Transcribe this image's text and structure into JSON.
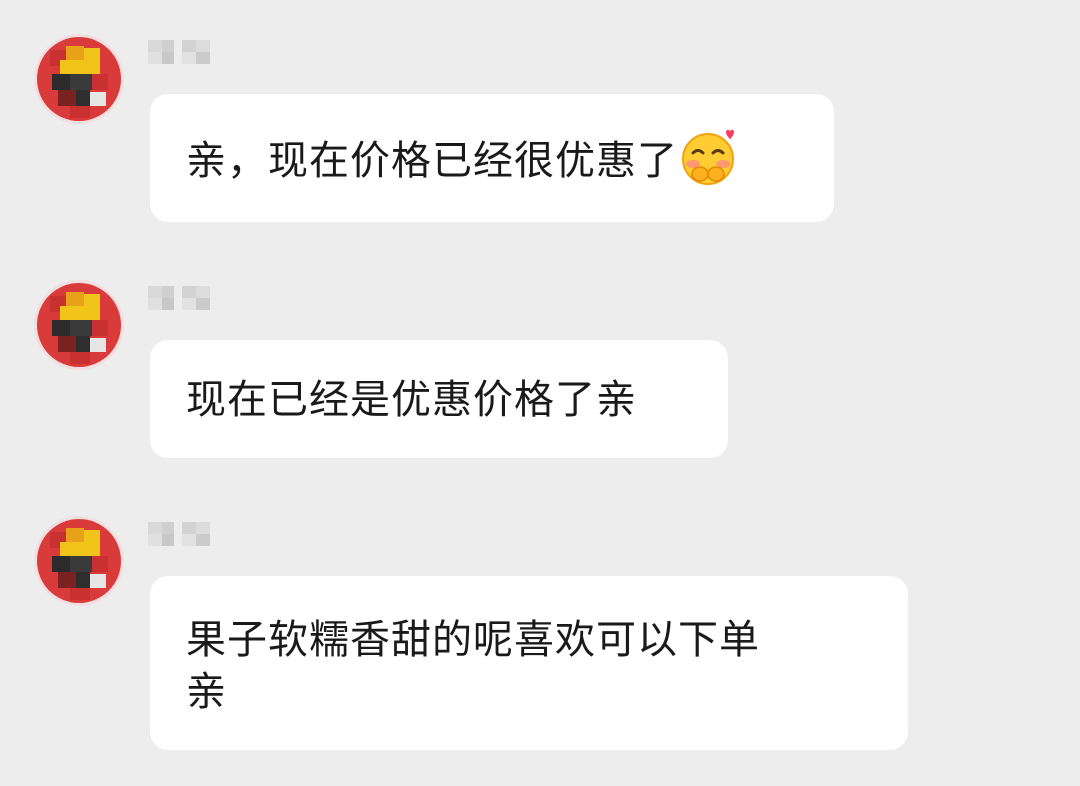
{
  "colors": {
    "background": "#ededed",
    "bubble": "#ffffff",
    "text": "#1a1a1a",
    "avatar_red": "#d93b3b",
    "avatar_yellow": "#f0c419"
  },
  "messages": [
    {
      "sender_name": "",
      "avatar_icon": "pixelated-avatar-icon",
      "text": "亲，现在价格已经很优惠了",
      "emoji": "blushing-smile-heart-emoji"
    },
    {
      "sender_name": "",
      "avatar_icon": "pixelated-avatar-icon",
      "text": "现在已经是优惠价格了亲"
    },
    {
      "sender_name": "",
      "avatar_icon": "pixelated-avatar-icon",
      "text_line_1": "果子软糯香甜的呢喜欢可以下单",
      "text_line_2": "亲"
    }
  ]
}
